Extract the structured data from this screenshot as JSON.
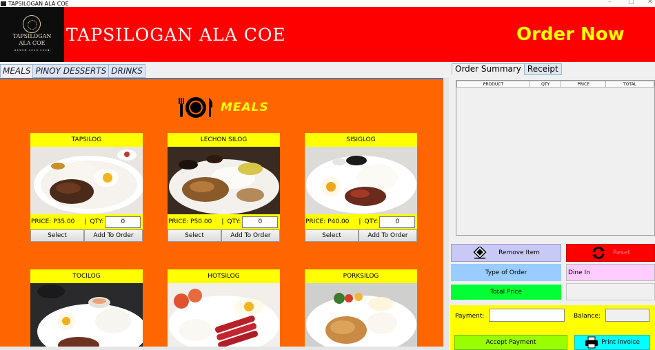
{
  "window": {
    "title": "TAPSILOGAN ALA COE",
    "controls": [
      "–",
      "□",
      "✕"
    ]
  },
  "header": {
    "logo": {
      "line1": "TAPSILOGAN",
      "line2": "ALA COE",
      "line3": "SINCE 2020 2024"
    },
    "brand": "TAPSILOGAN ALA COE",
    "order_now": "Order Now",
    "bg_color": "#ff0000",
    "order_now_color": "#ffff00"
  },
  "category_tabs": [
    "MEALS",
    "PINOY DESSERTS",
    "DRINKS"
  ],
  "menu": {
    "title": "MEALS",
    "bg_color": "#ff6600",
    "price_prefix": "PRICE:",
    "qty_label": "QTY:",
    "select_label": "Select",
    "add_label": "Add To Order",
    "items": [
      {
        "name": "TAPSILOG",
        "price": "P35.00",
        "qty": "0"
      },
      {
        "name": "LECHON SILOG",
        "price": "P50.00",
        "qty": "0"
      },
      {
        "name": "SISIGLOG",
        "price": "P40.00",
        "qty": "0"
      },
      {
        "name": "TOCILOG",
        "price": "",
        "qty": ""
      },
      {
        "name": "HOTSILOG",
        "price": "",
        "qty": ""
      },
      {
        "name": "PORKSILOG",
        "price": "",
        "qty": ""
      }
    ]
  },
  "right_tabs": [
    "Order Summary",
    "Receipt"
  ],
  "summary_columns": [
    "PRODUCT",
    "QTY",
    "PRICE",
    "TOTAL"
  ],
  "actions": {
    "remove_item": "Remove Item",
    "reset": "Reset",
    "type_of_order": "Type of Order",
    "order_type_value": "Dine In",
    "total_price": "Total Price",
    "total_price_value": "",
    "payment": "Payment:",
    "payment_value": "",
    "balance": "Balance:",
    "balance_value": "",
    "accept_payment": "Accept Payment",
    "print_invoice": "Print Invoice"
  }
}
